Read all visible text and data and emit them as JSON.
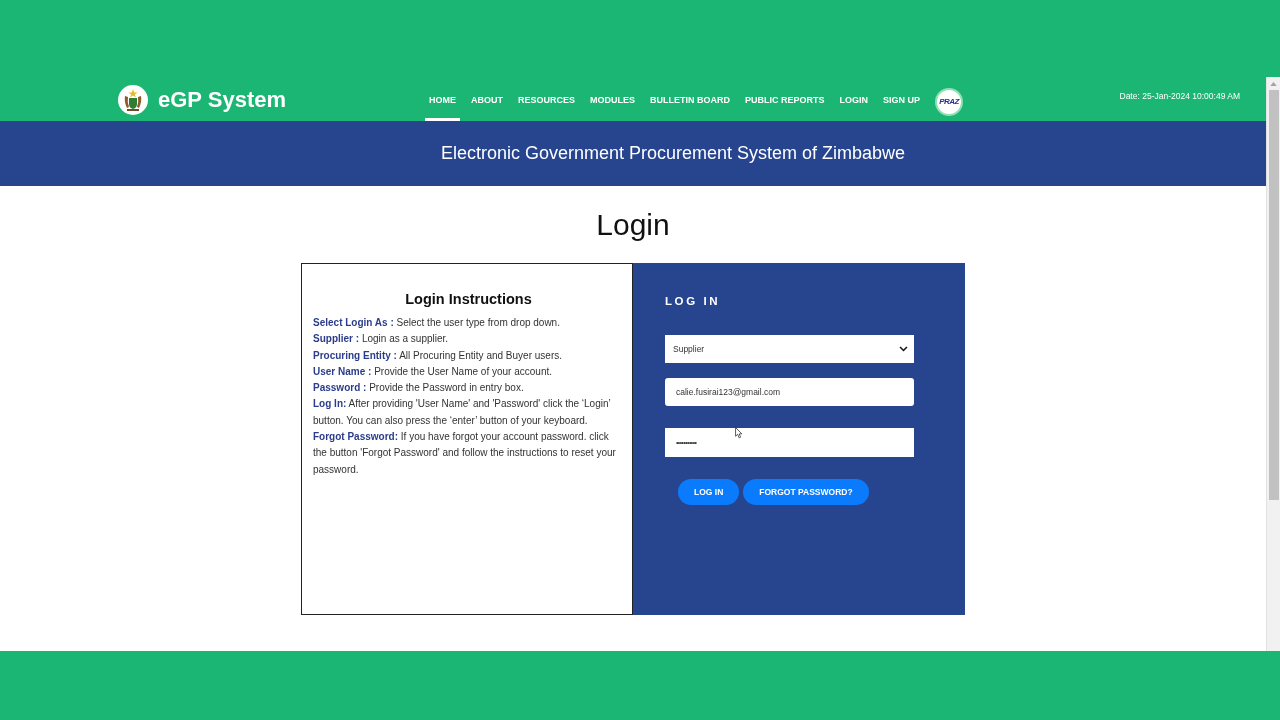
{
  "header": {
    "brand": "eGP System",
    "nav": [
      {
        "label": "HOME",
        "selected": true
      },
      {
        "label": "ABOUT",
        "selected": false
      },
      {
        "label": "RESOURCES",
        "selected": false
      },
      {
        "label": "MODULES",
        "selected": false
      },
      {
        "label": "BULLETIN BOARD",
        "selected": false
      },
      {
        "label": "PUBLIC REPORTS",
        "selected": false
      },
      {
        "label": "LOGIN",
        "selected": false
      },
      {
        "label": "SIGN UP",
        "selected": false
      }
    ],
    "partner_logo": "PRAZ",
    "date": "Date: 25-Jan-2024 10:00:49 AM"
  },
  "banner": {
    "title": "Electronic Government Procurement System of Zimbabwe"
  },
  "page": {
    "heading": "Login"
  },
  "instructions": {
    "title": "Login Instructions",
    "items": [
      "**Select Login As :** Select the user type from drop down.",
      "**Supplier :** Login as a supplier.",
      "**Procuring Entity :** All Procuring Entity and Buyer users.",
      "**User Name :** Provide the User Name of your account.",
      "**Password :** Provide the Password in entry box.",
      "**Log In:** After providing 'User Name' and 'Password' click the ‘Login’ button. You can also press the ‘enter’ button of your keyboard.",
      "**Forgot Password:** If you have forgot your account password. click the button 'Forgot Password' and follow the instructions to reset your password."
    ]
  },
  "login_form": {
    "title": "LOG IN",
    "login_as": {
      "value": "Supplier"
    },
    "username": {
      "value": "calie.fusirai123@gmail.com"
    },
    "password": {
      "value": "•••••••••••"
    },
    "buttons": [
      "LOG IN",
      "FORGOT PASSWORD?"
    ]
  }
}
